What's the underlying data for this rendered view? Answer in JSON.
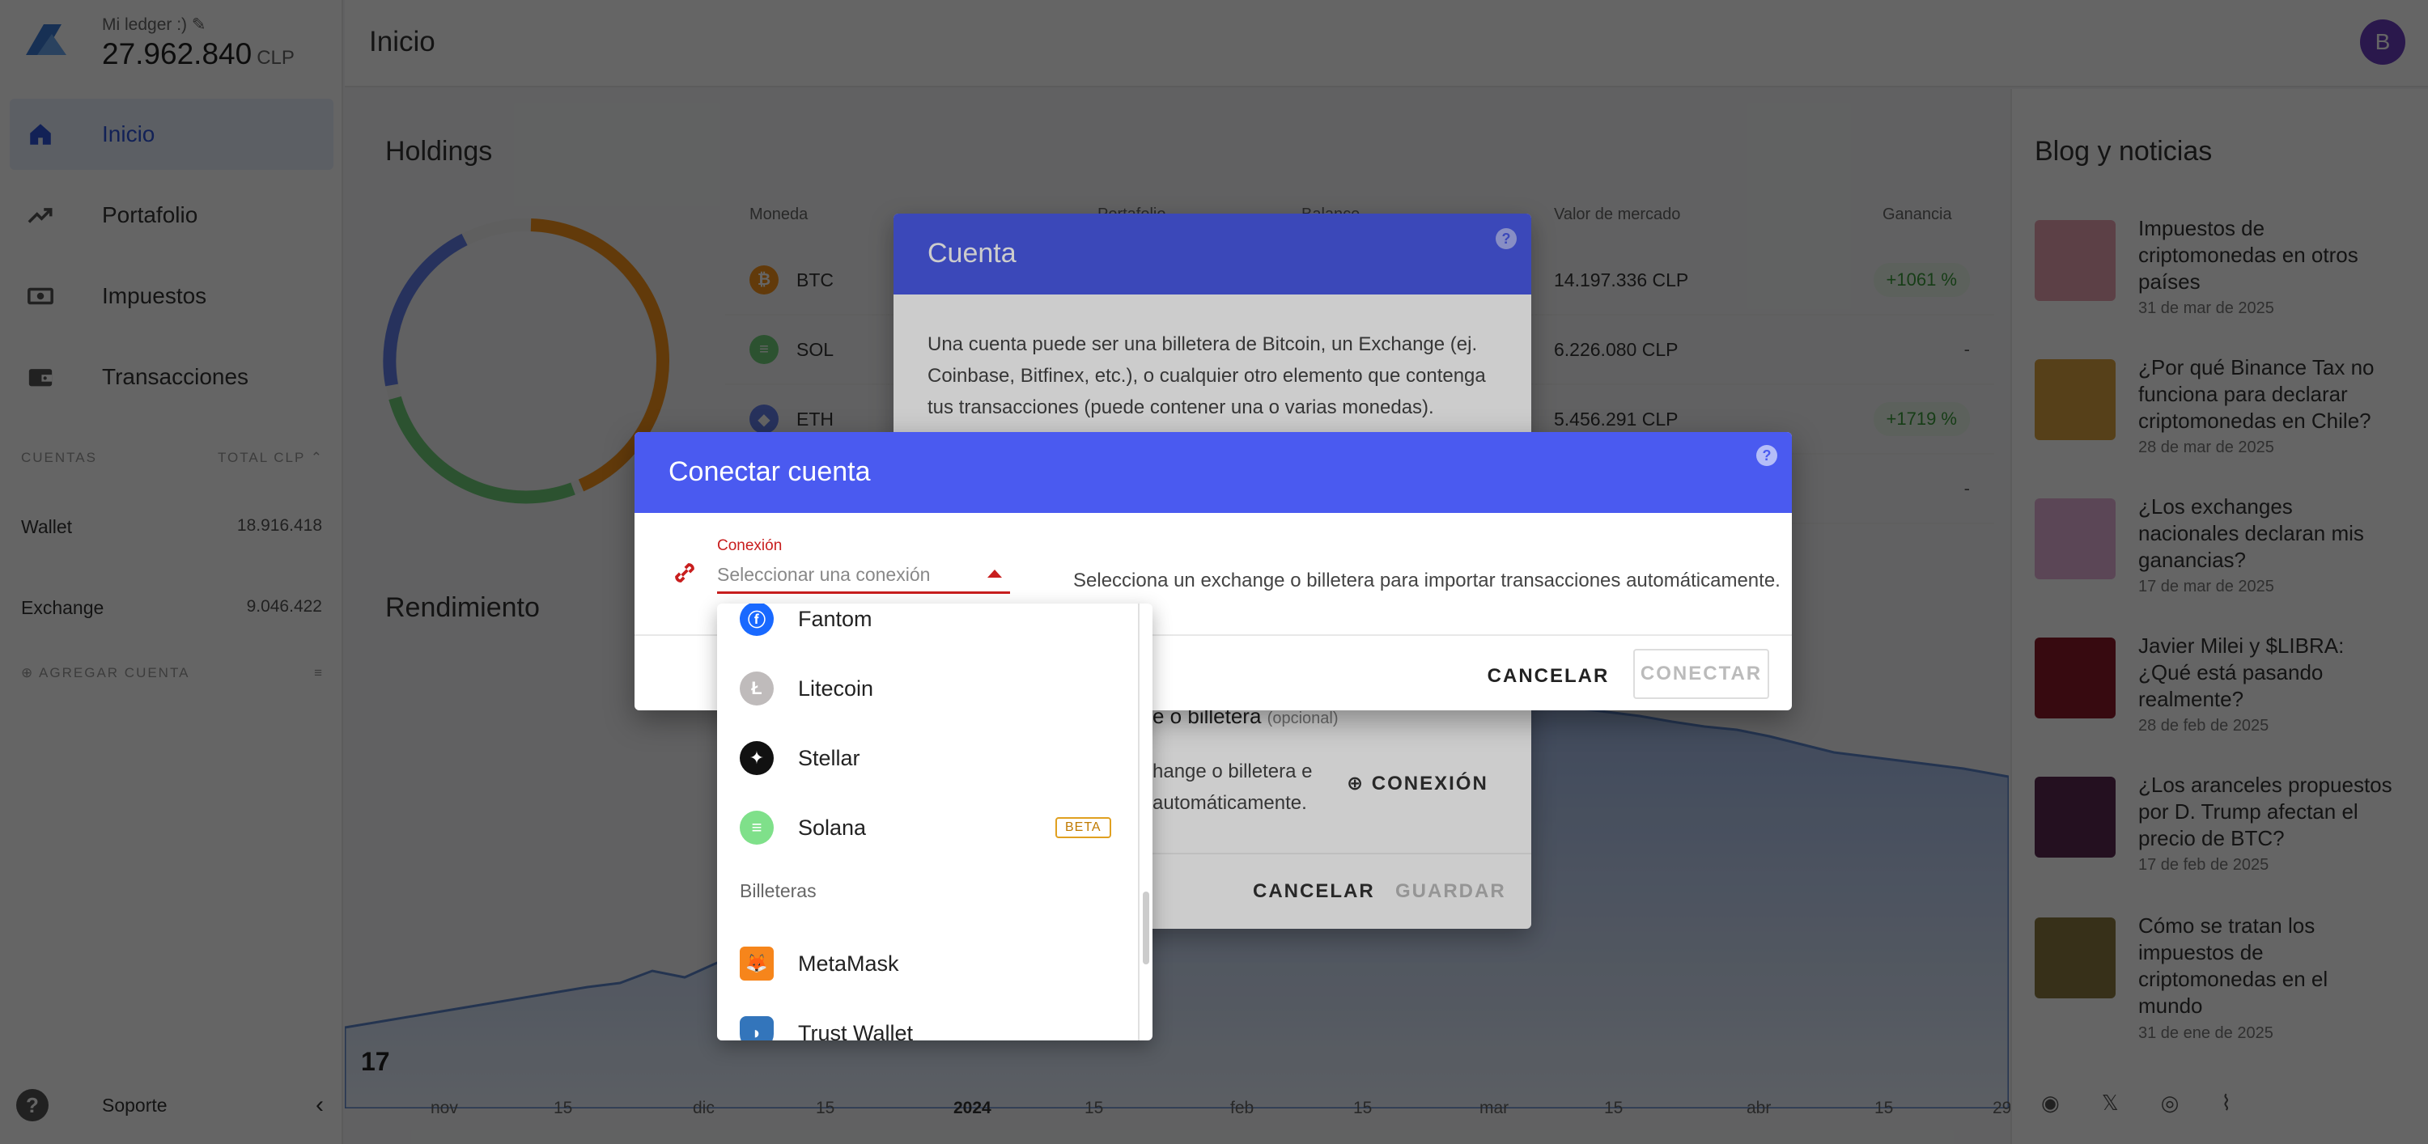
{
  "sidebar": {
    "ledger_name": "Mi ledger :)",
    "ledger_total": "27.962.840",
    "ledger_currency": "CLP",
    "nav": [
      {
        "label": "Inicio",
        "icon": "home-icon"
      },
      {
        "label": "Portafolio",
        "icon": "trending-up-icon"
      },
      {
        "label": "Impuestos",
        "icon": "cash-icon"
      },
      {
        "label": "Transacciones",
        "icon": "wallet-icon"
      }
    ],
    "accounts_heading": "CUENTAS",
    "accounts_total_heading": "TOTAL CLP",
    "accounts": [
      {
        "name": "Wallet",
        "value": "18.916.418"
      },
      {
        "name": "Exchange",
        "value": "9.046.422"
      }
    ],
    "add_account": "AGREGAR CUENTA",
    "support": "Soporte"
  },
  "topbar": {
    "title": "Inicio",
    "avatar_letter": "B"
  },
  "holdings": {
    "title": "Holdings",
    "columns": [
      "Moneda",
      "Portafolio",
      "Balance",
      "Valor de mercado",
      "Ganancia"
    ],
    "rows": [
      {
        "symbol": "BTC",
        "market_value": "14.197.336 CLP",
        "gain": "+1061 %",
        "color": "#f7931a"
      },
      {
        "symbol": "SOL",
        "market_value": "6.226.080 CLP",
        "gain": "-",
        "color": "#6fcf7a"
      },
      {
        "symbol": "ETH",
        "market_value": "5.456.291 CLP",
        "gain": "+1719 %",
        "color": "#627eea"
      },
      {
        "symbol": "",
        "market_value": "",
        "gain": "-",
        "color": "#ccc"
      }
    ]
  },
  "performance": {
    "title": "Rendimiento",
    "x_ticks": [
      "nov",
      "15",
      "dic",
      "15",
      "2024",
      "15",
      "feb",
      "15",
      "mar",
      "15",
      "abr",
      "15",
      "29"
    ]
  },
  "news": {
    "title": "Blog y noticias",
    "items": [
      {
        "title": "Impuestos de criptomonedas en otros países",
        "date": "31 de mar de 2025",
        "color": "#e8a0b0"
      },
      {
        "title": "¿Por qué Binance Tax no funciona para declarar criptomonedas en Chile?",
        "date": "28 de mar de 2025",
        "color": "#d9a040"
      },
      {
        "title": "¿Los exchanges nacionales declaran mis ganancias?",
        "date": "17 de mar de 2025",
        "color": "#e4b0d8"
      },
      {
        "title": "Javier Milei y $LIBRA: ¿Qué está pasando realmente?",
        "date": "28 de feb de 2025",
        "color": "#8a1a2a"
      },
      {
        "title": "¿Los aranceles propuestos por D. Trump afectan el precio de BTC?",
        "date": "17 de feb de 2025",
        "color": "#5a2a50"
      },
      {
        "title": "Cómo se tratan los impuestos de criptomonedas en el mundo",
        "date": "31 de ene de 2025",
        "color": "#8a7a40"
      }
    ]
  },
  "dialog_cuenta": {
    "title": "Cuenta",
    "body": "Una cuenta puede ser una billetera de Bitcoin, un Exchange (ej. Coinbase, Bitfinex, etc.), o cualquier otro elemento que contenga tus transacciones (puede contener una o varias monedas).",
    "section_label": "e o billetera",
    "optional": "(opcional)",
    "hint_1": "hange o billetera e",
    "hint_2": "automáticamente.",
    "connection_button": "CONEXIÓN",
    "cancel": "CANCELAR",
    "save": "GUARDAR"
  },
  "dialog_conectar": {
    "title": "Conectar cuenta",
    "field_label": "Conexión",
    "placeholder": "Seleccionar una conexión",
    "help_text": "Selecciona un exchange o billetera para importar transacciones automáticamente.",
    "cancel": "CANCELAR",
    "connect": "CONECTAR"
  },
  "dropdown": {
    "items": [
      {
        "name": "Fantom",
        "icon": "fantom-icon",
        "color": "#1969ff"
      },
      {
        "name": "Litecoin",
        "icon": "litecoin-icon",
        "color": "#bfbbbb"
      },
      {
        "name": "Stellar",
        "icon": "stellar-icon",
        "color": "#111111"
      },
      {
        "name": "Solana",
        "icon": "solana-icon",
        "color": "#7fe08a",
        "badge": "BETA"
      }
    ],
    "group_label": "Billeteras",
    "wallets": [
      {
        "name": "MetaMask",
        "icon": "metamask-icon",
        "color": "#f6851b"
      },
      {
        "name": "Trust Wallet",
        "icon": "trust-wallet-icon",
        "color": "#3375bb"
      }
    ]
  }
}
